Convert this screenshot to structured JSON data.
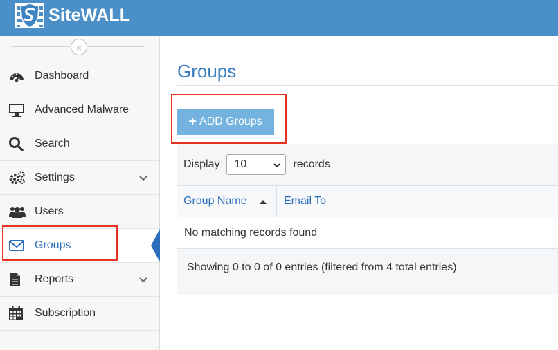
{
  "app": {
    "brand": "SiteWALL"
  },
  "sidebar": {
    "collapse_symbol": "«",
    "items": [
      {
        "label": "Dashboard",
        "icon": "dashboard-icon"
      },
      {
        "label": "Advanced Malware",
        "icon": "monitor-icon"
      },
      {
        "label": "Search",
        "icon": "search-icon"
      },
      {
        "label": "Settings",
        "icon": "gears-icon",
        "expandable": true
      },
      {
        "label": "Users",
        "icon": "users-icon"
      },
      {
        "label": "Groups",
        "icon": "envelope-icon",
        "active": true
      },
      {
        "label": "Reports",
        "icon": "file-icon",
        "expandable": true
      },
      {
        "label": "Subscription",
        "icon": "calendar-icon"
      }
    ]
  },
  "main": {
    "title": "Groups",
    "add_button": "ADD Groups",
    "display_label": "Display",
    "records_label": "records",
    "page_size": "10",
    "columns": [
      "Group Name",
      "Email To"
    ],
    "empty_text": "No matching records found",
    "info_text": "Showing 0 to 0 of 0 entries (filtered from 4 total entries)"
  },
  "colors": {
    "header": "#4a8fc7",
    "accent": "#2a6ebb",
    "button": "#74b2e0",
    "highlight": "#e53322"
  }
}
